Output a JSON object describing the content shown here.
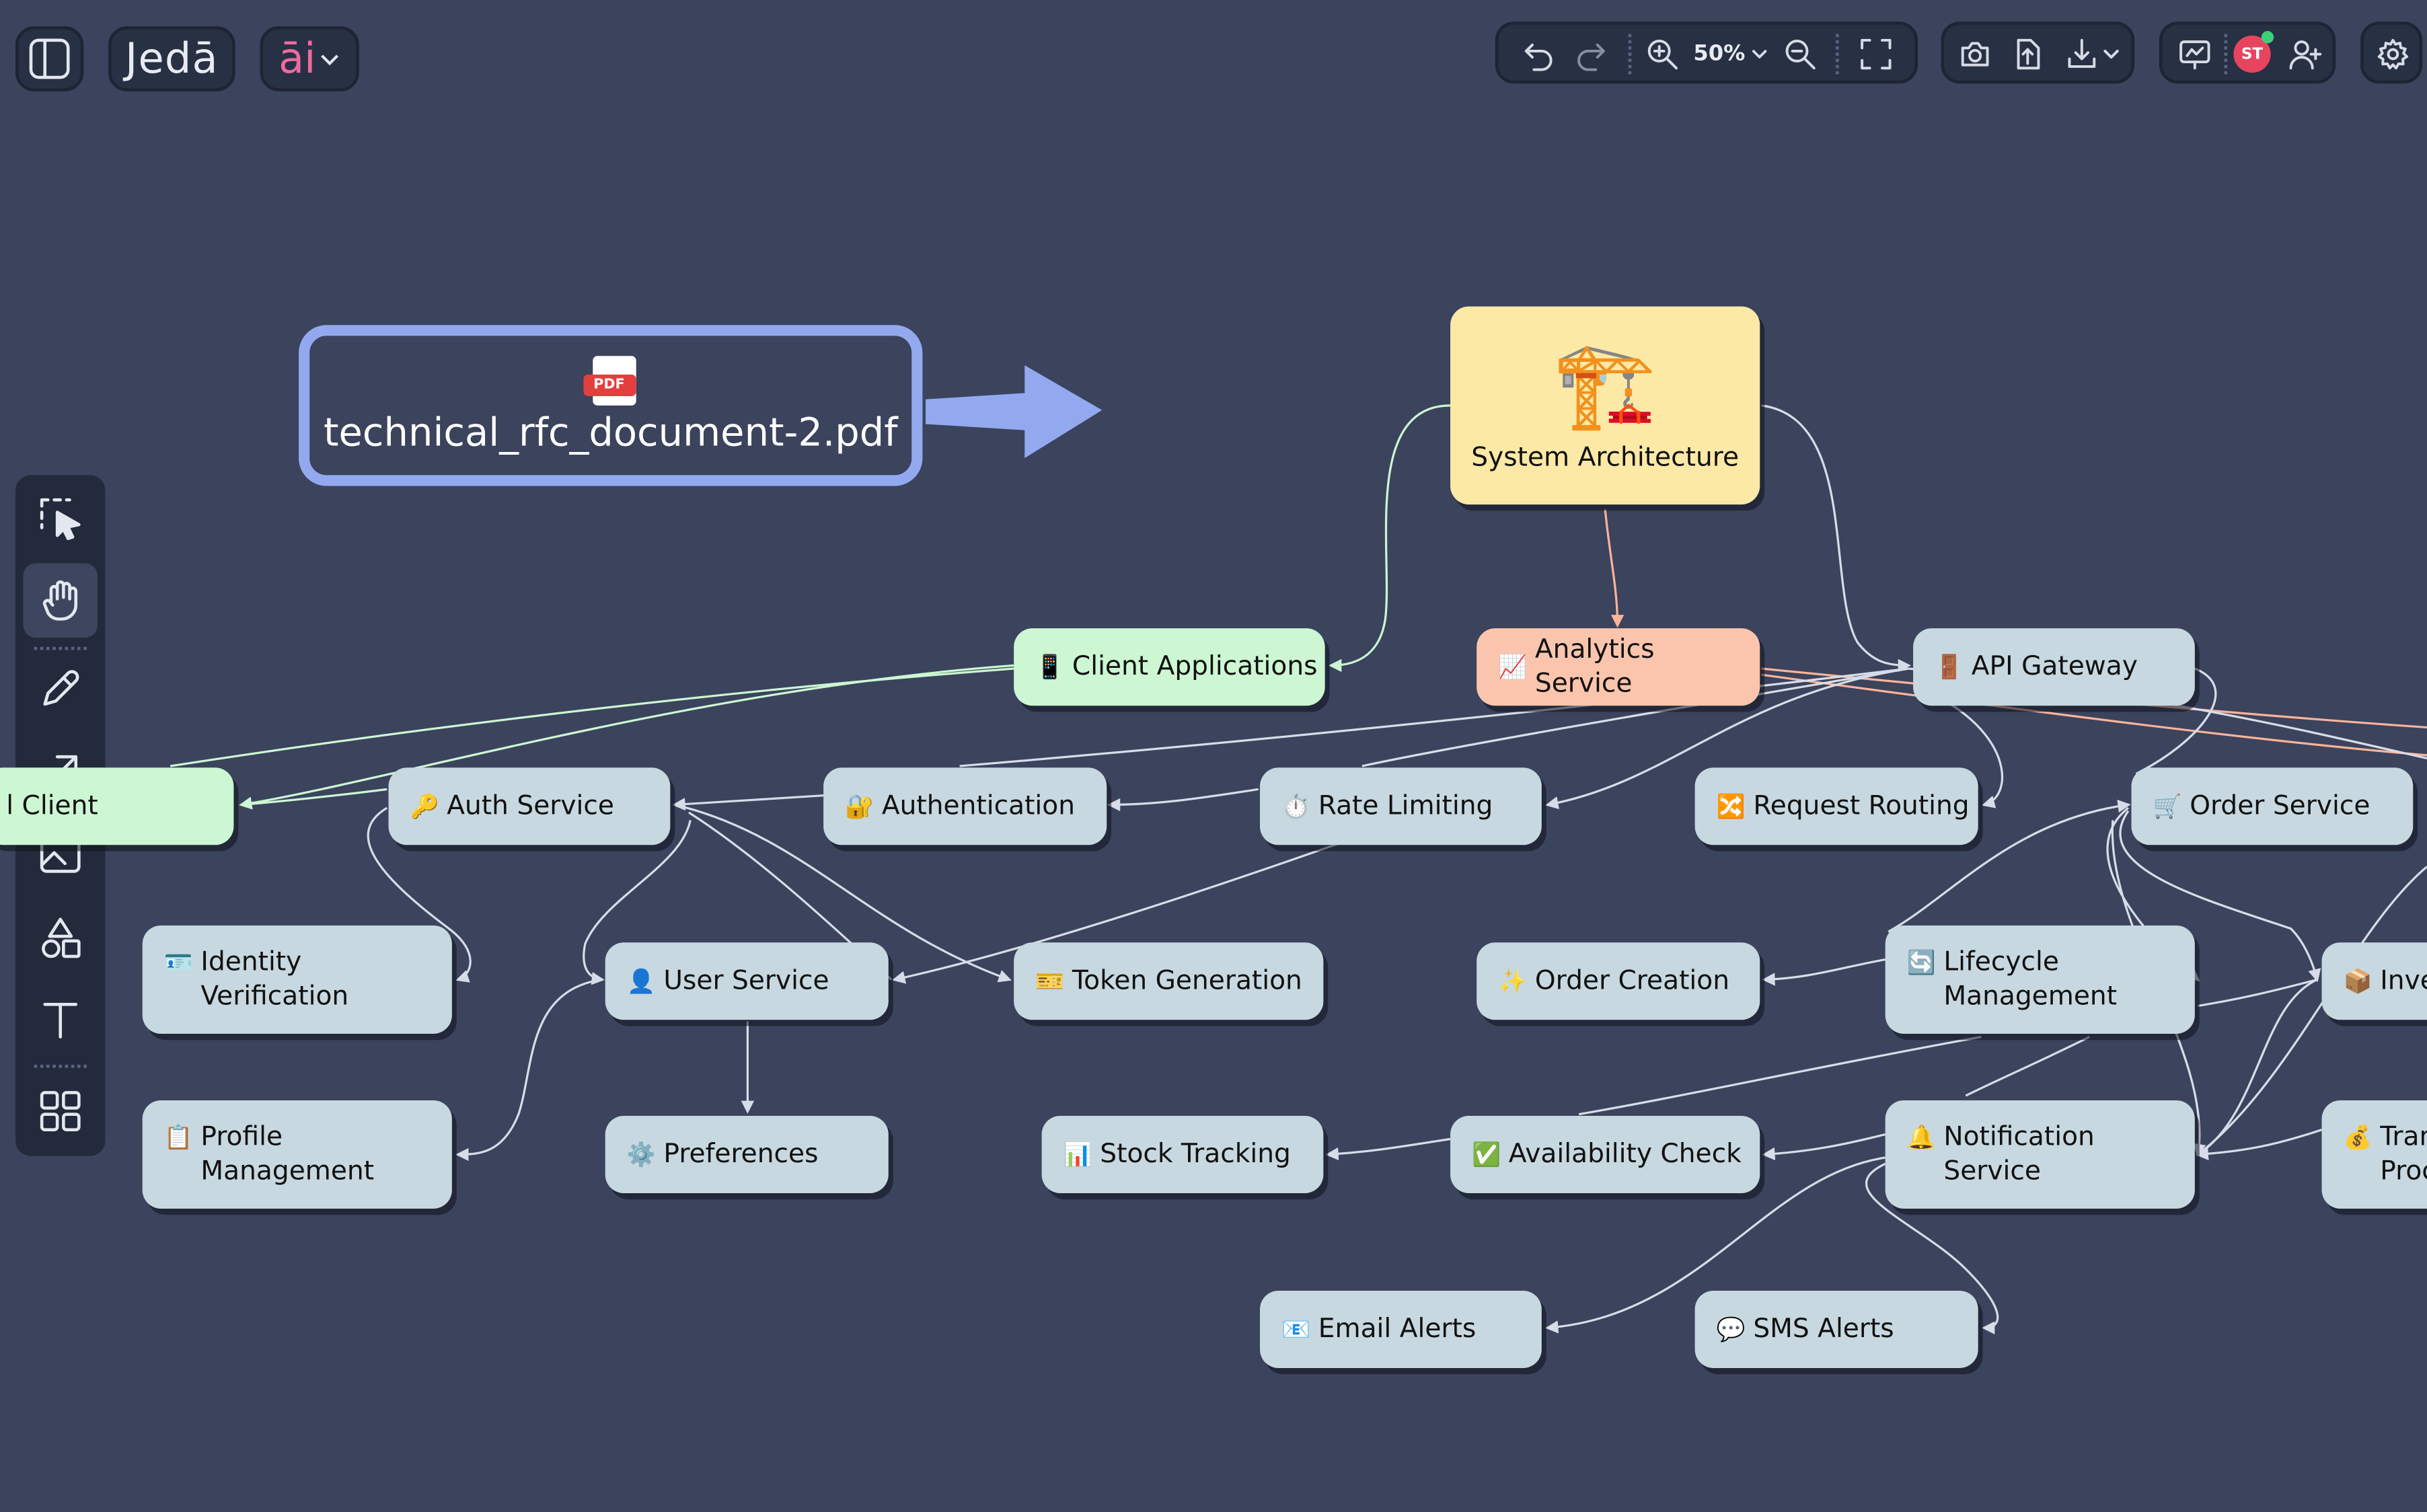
{
  "brand": {
    "logo_text": "Jedā",
    "ai_label": "āi"
  },
  "toolbar": {
    "zoom_label": "50%"
  },
  "user": {
    "initials": "ST",
    "accent": "#e8445f"
  },
  "document": {
    "badge": "PDF",
    "filename": "technical_rfc_document-2.pdf"
  },
  "colors": {
    "canvas": "#3b435d",
    "node": "#c7d8e0",
    "client_node": "#ccf7d2",
    "analytics_node": "#fbc5ad",
    "root_node": "#fde9a6",
    "arrow": "#93a9ef"
  },
  "nodes": {
    "system_architecture": {
      "icon": "🏗️",
      "label": "System Architecture"
    },
    "client_applications": {
      "icon": "📱",
      "label": "Client Applications"
    },
    "analytics_service": {
      "icon": "📈",
      "label": "Analytics Service"
    },
    "api_gateway": {
      "icon": "🚪",
      "label": "API Gateway"
    },
    "client": {
      "label": "l Client"
    },
    "auth_service": {
      "icon": "🔑",
      "label": "Auth Service"
    },
    "authentication": {
      "icon": "🔐",
      "label": "Authentication"
    },
    "rate_limiting": {
      "icon": "⏱️",
      "label": "Rate Limiting"
    },
    "request_routing": {
      "icon": "🔀",
      "label": "Request Routing"
    },
    "order_service": {
      "icon": "🛒",
      "label": "Order Service"
    },
    "identity_verification": {
      "icon": "🪪",
      "label": "Identity\nVerification"
    },
    "user_service": {
      "icon": "👤",
      "label": "User Service"
    },
    "token_generation": {
      "icon": "🎫",
      "label": "Token Generation"
    },
    "order_creation": {
      "icon": "✨",
      "label": "Order Creation"
    },
    "lifecycle_management": {
      "icon": "🔄",
      "label": "Lifecycle\nManagement"
    },
    "inventory": {
      "icon": "📦",
      "label": "Inve"
    },
    "profile_management": {
      "icon": "📋",
      "label": "Profile\nManagement"
    },
    "preferences": {
      "icon": "⚙️",
      "label": "Preferences"
    },
    "stock_tracking": {
      "icon": "📊",
      "label": "Stock Tracking"
    },
    "availability_check": {
      "icon": "✅",
      "label": "Availability Check"
    },
    "notification_service": {
      "icon": "🔔",
      "label": "Notification\nService"
    },
    "transaction_processing": {
      "icon": "💰",
      "label": "Tran\nProces"
    },
    "email_alerts": {
      "icon": "📧",
      "label": "Email Alerts"
    },
    "sms_alerts": {
      "icon": "💬",
      "label": "SMS Alerts"
    }
  }
}
